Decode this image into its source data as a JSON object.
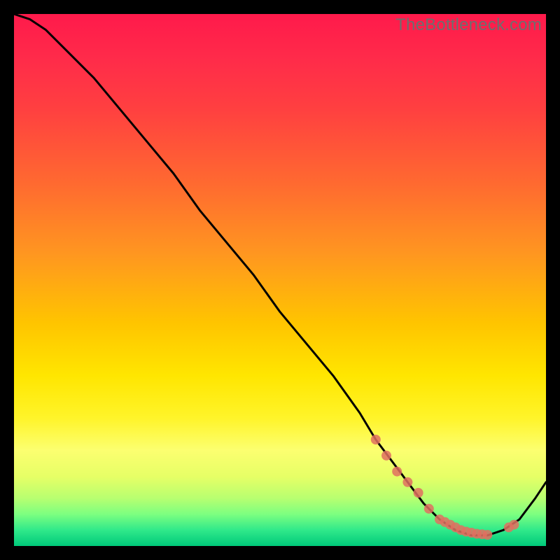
{
  "watermark": "TheBottleneck.com",
  "chart_data": {
    "type": "line",
    "title": "",
    "xlabel": "",
    "ylabel": "",
    "xlim": [
      0,
      100
    ],
    "ylim": [
      0,
      100
    ],
    "grid": false,
    "series": [
      {
        "name": "curve",
        "stroke": "#000000",
        "x": [
          0,
          3,
          6,
          10,
          15,
          20,
          25,
          30,
          35,
          40,
          45,
          50,
          55,
          60,
          65,
          68,
          71,
          74,
          77,
          80,
          83,
          86,
          89,
          92,
          95,
          98,
          100
        ],
        "y": [
          100,
          99,
          97,
          93,
          88,
          82,
          76,
          70,
          63,
          57,
          51,
          44,
          38,
          32,
          25,
          20,
          16,
          12,
          8,
          5,
          3,
          2,
          2,
          3,
          5,
          9,
          12
        ]
      }
    ],
    "markers": {
      "name": "highlight-dots",
      "fill": "#e07060",
      "x": [
        68,
        70,
        72,
        74,
        76,
        78,
        80,
        81,
        82,
        83,
        84,
        85,
        86,
        87,
        88,
        89,
        93,
        94
      ],
      "y": [
        20,
        17,
        14,
        12,
        10,
        7,
        5,
        4.5,
        4,
        3.5,
        3,
        2.7,
        2.5,
        2.3,
        2.2,
        2.1,
        3.5,
        4
      ]
    }
  }
}
